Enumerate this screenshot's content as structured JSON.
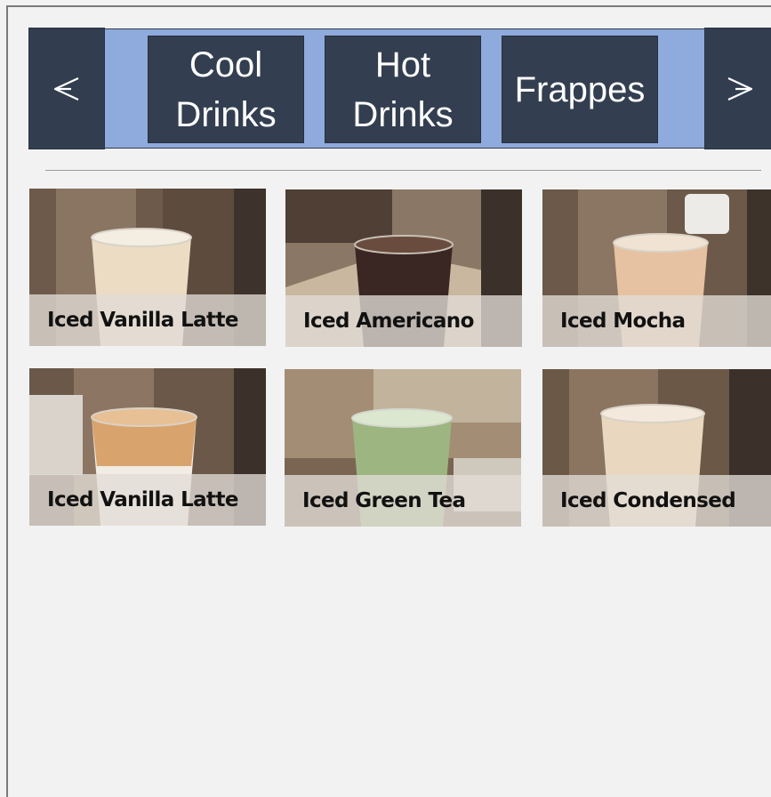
{
  "navigation": {
    "prev_icon": "chevron-left-icon",
    "next_icon": "chevron-right-icon"
  },
  "categories": [
    {
      "label": "Cool Drinks",
      "line1": "Cool",
      "line2": "Drinks"
    },
    {
      "label": "Hot Drinks",
      "line1": "Hot",
      "line2": "Drinks"
    },
    {
      "label": "Frappes",
      "line1": "Frappes",
      "line2": ""
    }
  ],
  "products": [
    {
      "name": "Iced Vanilla Latte",
      "drink_color": "#ecdcc4"
    },
    {
      "name": "Iced Americano",
      "drink_color": "#3a2723"
    },
    {
      "name": "Iced Mocha",
      "drink_color": "#e6c2a2"
    },
    {
      "name": "Iced Vanilla Latte",
      "drink_color": "#d9a36d"
    },
    {
      "name": "Iced Green Tea",
      "drink_color": "#9db681"
    },
    {
      "name": "Iced Condensed",
      "drink_color": "#ead7bf"
    }
  ],
  "colors": {
    "nav_dark": "#323e50",
    "strip_blue": "#8faadc",
    "background": "#f2f2f2"
  }
}
